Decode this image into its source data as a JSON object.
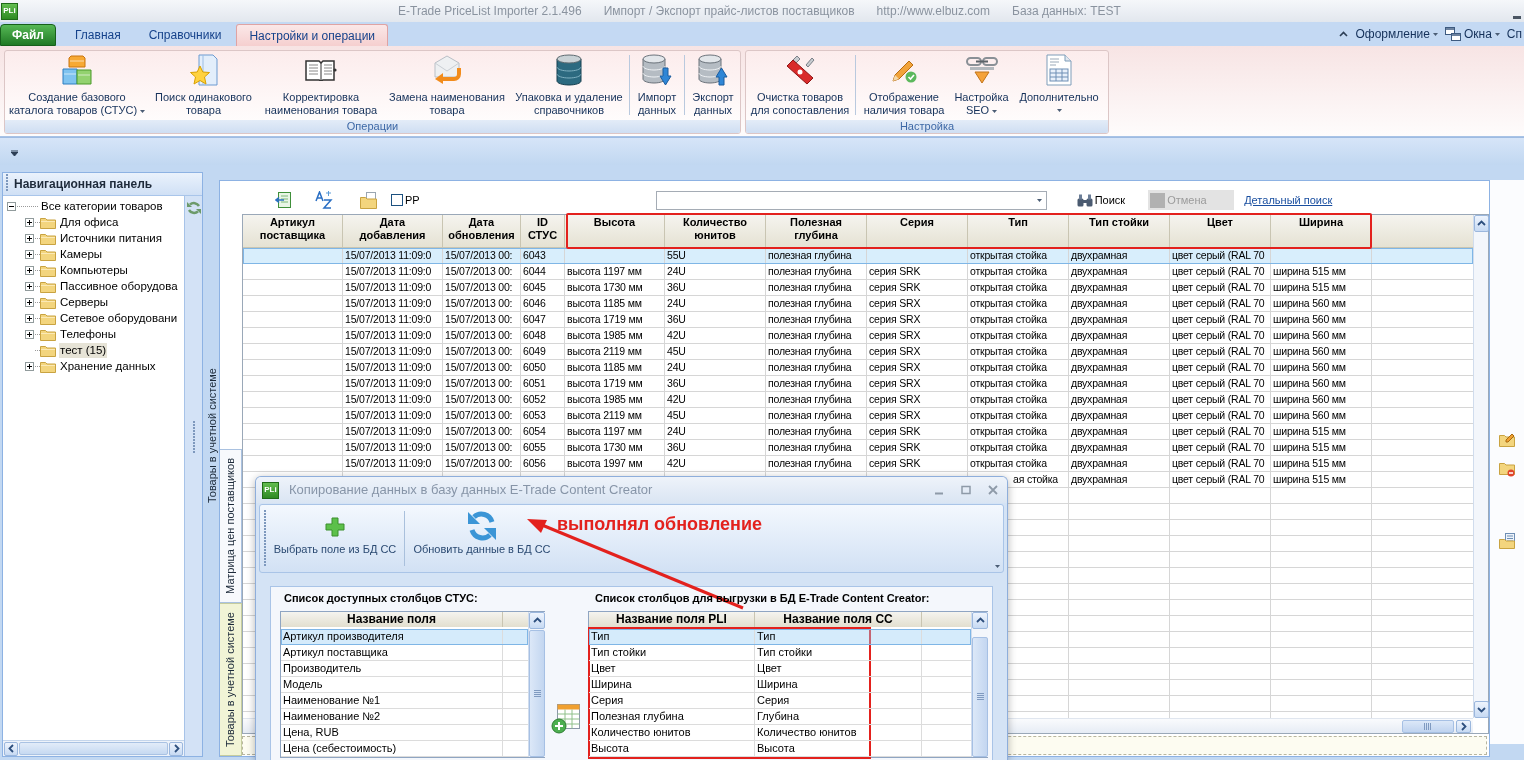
{
  "window": {
    "icon_text": "PLi",
    "title_parts": [
      "E-Trade PriceList Importer 2.1.496",
      "Импорт / Экспорт прайс-листов поставщиков",
      "http://www.elbuz.com",
      "База данных: TEST"
    ]
  },
  "ribbon": {
    "file_tab": "Файл",
    "tabs": [
      {
        "label": "Главная",
        "selected": false
      },
      {
        "label": "Справочники",
        "selected": false
      },
      {
        "label": "Настройки и операции",
        "selected": true
      }
    ],
    "right_menu": [
      {
        "label": "Оформление",
        "kind": "dropdown"
      },
      {
        "label": "Окна",
        "kind": "windows"
      },
      {
        "label": "Сп",
        "kind": "plain"
      }
    ],
    "groups": [
      {
        "label": "Операции",
        "buttons": [
          {
            "label": "Создание базового\nкаталога товаров (СТУС)",
            "kind": "dropdown",
            "separator_before": false
          },
          {
            "label": "Поиск одинакового\nтовара",
            "kind": "plain",
            "separator_before": false
          },
          {
            "label": "Корректировка\nнаименования товара",
            "kind": "plain",
            "separator_before": false
          },
          {
            "label": "Замена наименования\nтовара",
            "kind": "plain",
            "separator_before": false
          },
          {
            "label": "Упаковка и удаление\nсправочников",
            "kind": "plain",
            "separator_before": false
          },
          {
            "label": "Импорт\nданных",
            "kind": "plain",
            "separator_before": true
          },
          {
            "label": "Экспорт\nданных",
            "kind": "plain",
            "separator_before": true
          }
        ]
      },
      {
        "label": "Настройка",
        "buttons": [
          {
            "label": "Очистка товаров\nдля сопоставления",
            "kind": "plain",
            "separator_before": false
          },
          {
            "label": "Отображение\nналичия товара",
            "kind": "plain",
            "separator_before": true
          },
          {
            "label": "Настройка\nSEO",
            "kind": "dropdown",
            "separator_before": false
          },
          {
            "label": "Дополнительно",
            "kind": "dropdown_below",
            "separator_before": false
          }
        ]
      }
    ]
  },
  "navigation": {
    "title": "Навигационная панель",
    "tree": [
      {
        "label": "Все категории товаров",
        "expanded": true,
        "selected": false,
        "children": [
          {
            "label": "Для офиса",
            "expanded": false,
            "selected": false
          },
          {
            "label": "Источники питания",
            "expanded": false,
            "selected": false
          },
          {
            "label": "Камеры",
            "expanded": false,
            "selected": false
          },
          {
            "label": "Компьютеры",
            "expanded": false,
            "selected": false
          },
          {
            "label": "Пассивное оборудова",
            "expanded": false,
            "selected": false
          },
          {
            "label": "Серверы",
            "expanded": false,
            "selected": false
          },
          {
            "label": "Сетевое оборудовани",
            "expanded": false,
            "selected": false
          },
          {
            "label": "Телефоны",
            "expanded": false,
            "selected": false
          },
          {
            "label": "тест (15)",
            "selected": true
          },
          {
            "label": "Хранение данных",
            "expanded": false,
            "selected": false
          }
        ]
      }
    ]
  },
  "dock_tab": "Товары в учетной системе",
  "view_tabs": [
    {
      "label": "Матрица цен поставщиков",
      "selected": true
    },
    {
      "label": "Товары в учетной системе",
      "selected": false
    }
  ],
  "toolbar": {
    "checkbox": {
      "label": "PP",
      "checked": false
    },
    "search_button": "Поиск",
    "cancel_button": {
      "label": "Отмена",
      "disabled": true
    },
    "detail_link": "Детальный поиск"
  },
  "grid": {
    "columns": [
      "Артикул\nпоставщика",
      "Дата\nдобавления",
      "Дата\nобновления",
      "ID\nСТУС",
      "Высота",
      "Количество\nюнитов",
      "Полезная\nглубина",
      "Серия",
      "Тип",
      "Тип стойки",
      "Цвет",
      "Ширина"
    ],
    "rows": [
      {
        "kind": "normal",
        "selected": true,
        "cells": [
          null,
          "15/07/2013 11:09:0",
          "15/07/2013 00:",
          "6043",
          null,
          "55U",
          "полезная глубина",
          null,
          "открытая стойка",
          "двухрамная",
          "цвет серый (RAL 70",
          null
        ]
      },
      {
        "kind": "normal",
        "selected": false,
        "cells": [
          null,
          "15/07/2013 11:09:0",
          "15/07/2013 00:",
          "6044",
          "высота 1197 мм",
          "24U",
          "полезная глубина",
          "серия SRK",
          "открытая стойка",
          "двухрамная",
          "цвет серый (RAL 70",
          "ширина 515 мм"
        ]
      },
      {
        "kind": "normal",
        "selected": false,
        "cells": [
          null,
          "15/07/2013 11:09:0",
          "15/07/2013 00:",
          "6045",
          "высота 1730 мм",
          "36U",
          "полезная глубина",
          "серия SRK",
          "открытая стойка",
          "двухрамная",
          "цвет серый (RAL 70",
          "ширина 515 мм"
        ]
      },
      {
        "kind": "normal",
        "selected": false,
        "cells": [
          null,
          "15/07/2013 11:09:0",
          "15/07/2013 00:",
          "6046",
          "высота 1185 мм",
          "24U",
          "полезная глубина",
          "серия SRX",
          "открытая стойка",
          "двухрамная",
          "цвет серый (RAL 70",
          "ширина 560 мм"
        ]
      },
      {
        "kind": "normal",
        "selected": false,
        "cells": [
          null,
          "15/07/2013 11:09:0",
          "15/07/2013 00:",
          "6047",
          "высота 1719 мм",
          "36U",
          "полезная глубина",
          "серия SRX",
          "открытая стойка",
          "двухрамная",
          "цвет серый (RAL 70",
          "ширина 560 мм"
        ]
      },
      {
        "kind": "normal",
        "selected": false,
        "cells": [
          null,
          "15/07/2013 11:09:0",
          "15/07/2013 00:",
          "6048",
          "высота 1985 мм",
          "42U",
          "полезная глубина",
          "серия SRX",
          "открытая стойка",
          "двухрамная",
          "цвет серый (RAL 70",
          "ширина 560 мм"
        ]
      },
      {
        "kind": "normal",
        "selected": false,
        "cells": [
          null,
          "15/07/2013 11:09:0",
          "15/07/2013 00:",
          "6049",
          "высота 2119 мм",
          "45U",
          "полезная глубина",
          "серия SRX",
          "открытая стойка",
          "двухрамная",
          "цвет серый (RAL 70",
          "ширина 560 мм"
        ]
      },
      {
        "kind": "normal",
        "selected": false,
        "cells": [
          null,
          "15/07/2013 11:09:0",
          "15/07/2013 00:",
          "6050",
          "высота 1185 мм",
          "24U",
          "полезная глубина",
          "серия SRX",
          "открытая стойка",
          "двухрамная",
          "цвет серый (RAL 70",
          "ширина 560 мм"
        ]
      },
      {
        "kind": "normal",
        "selected": false,
        "cells": [
          null,
          "15/07/2013 11:09:0",
          "15/07/2013 00:",
          "6051",
          "высота 1719 мм",
          "36U",
          "полезная глубина",
          "серия SRX",
          "открытая стойка",
          "двухрамная",
          "цвет серый (RAL 70",
          "ширина 560 мм"
        ]
      },
      {
        "kind": "normal",
        "selected": false,
        "cells": [
          null,
          "15/07/2013 11:09:0",
          "15/07/2013 00:",
          "6052",
          "высота 1985 мм",
          "42U",
          "полезная глубина",
          "серия SRX",
          "открытая стойка",
          "двухрамная",
          "цвет серый (RAL 70",
          "ширина 560 мм"
        ]
      },
      {
        "kind": "normal",
        "selected": false,
        "cells": [
          null,
          "15/07/2013 11:09:0",
          "15/07/2013 00:",
          "6053",
          "высота 2119 мм",
          "45U",
          "полезная глубина",
          "серия SRX",
          "открытая стойка",
          "двухрамная",
          "цвет серый (RAL 70",
          "ширина 560 мм"
        ]
      },
      {
        "kind": "normal",
        "selected": false,
        "cells": [
          null,
          "15/07/2013 11:09:0",
          "15/07/2013 00:",
          "6054",
          "высота 1197 мм",
          "24U",
          "полезная глубина",
          "серия SRK",
          "открытая стойка",
          "двухрамная",
          "цвет серый (RAL 70",
          "ширина 515 мм"
        ]
      },
      {
        "kind": "normal",
        "selected": false,
        "cells": [
          null,
          "15/07/2013 11:09:0",
          "15/07/2013 00:",
          "6055",
          "высота 1730 мм",
          "36U",
          "полезная глубина",
          "серия SRK",
          "открытая стойка",
          "двухрамная",
          "цвет серый (RAL 70",
          "ширина 515 мм"
        ]
      },
      {
        "kind": "normal",
        "selected": false,
        "cells": [
          null,
          "15/07/2013 11:09:0",
          "15/07/2013 00:",
          "6056",
          "высота 1997 мм",
          "42U",
          "полезная глубина",
          "серия SRK",
          "открытая стойка",
          "двухрамная",
          "цвет серый (RAL 70",
          "ширина 515 мм"
        ]
      },
      {
        "kind": "covered",
        "selected": false,
        "cells": [
          null,
          null,
          null,
          null,
          null,
          null,
          null,
          null,
          "ая стойка",
          "двухрамная",
          "цвет серый (RAL 70",
          "ширина 515 мм"
        ]
      }
    ]
  },
  "dialog": {
    "icon_text": "PLi",
    "title": "Копирование данных в базу данных E-Trade Content Creator",
    "toolbar": [
      "Выбрать поле из БД CC",
      "Обновить данные в БД CC"
    ],
    "available": {
      "caption": "Список доступных столбцов СТУС:",
      "columns": [
        "Название поля"
      ],
      "rows": [
        {
          "cells": [
            "Артикул производителя"
          ],
          "selected": true
        },
        {
          "cells": [
            "Артикул поставщика"
          ],
          "selected": false
        },
        {
          "cells": [
            "Производитель"
          ],
          "selected": false
        },
        {
          "cells": [
            "Модель"
          ],
          "selected": false
        },
        {
          "cells": [
            "Наименование №1"
          ],
          "selected": false
        },
        {
          "cells": [
            "Наименование №2"
          ],
          "selected": false
        },
        {
          "cells": [
            "Цена, RUB"
          ],
          "selected": false
        },
        {
          "cells": [
            "Цена (себестоимость)"
          ],
          "selected": false
        }
      ]
    },
    "export": {
      "caption": "Список столбцов для выгрузки в БД E-Trade Content Creator:",
      "columns": [
        "Название поля PLI",
        "Название поля CC"
      ],
      "rows": [
        {
          "cells": [
            "Тип",
            "Тип"
          ],
          "selected": true
        },
        {
          "cells": [
            "Тип стойки",
            "Тип стойки"
          ],
          "selected": false
        },
        {
          "cells": [
            "Цвет",
            "Цвет"
          ],
          "selected": false
        },
        {
          "cells": [
            "Ширина",
            "Ширина"
          ],
          "selected": false
        },
        {
          "cells": [
            "Серия",
            "Серия"
          ],
          "selected": false
        },
        {
          "cells": [
            "Полезная глубина",
            "Глубина"
          ],
          "selected": false
        },
        {
          "cells": [
            "Количество юнитов",
            "Количество юнитов"
          ],
          "selected": false
        },
        {
          "cells": [
            "Высота",
            "Высота"
          ],
          "selected": false
        }
      ]
    }
  },
  "annotation": {
    "text": "выполнял обновление"
  }
}
